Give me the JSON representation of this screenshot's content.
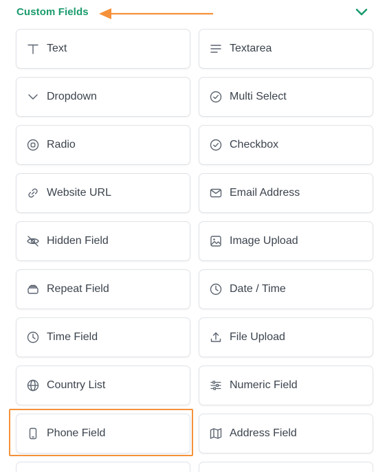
{
  "header": {
    "title": "Custom Fields",
    "accent_color": "#1a9b6c",
    "annotation_color": "#f5913a"
  },
  "fields": [
    {
      "label": "Text",
      "icon": "text-icon"
    },
    {
      "label": "Textarea",
      "icon": "textarea-icon"
    },
    {
      "label": "Dropdown",
      "icon": "chevron-down-icon"
    },
    {
      "label": "Multi Select",
      "icon": "check-circle-icon"
    },
    {
      "label": "Radio",
      "icon": "radio-icon"
    },
    {
      "label": "Checkbox",
      "icon": "check-circle-icon"
    },
    {
      "label": "Website URL",
      "icon": "link-icon"
    },
    {
      "label": "Email Address",
      "icon": "envelope-icon"
    },
    {
      "label": "Hidden Field",
      "icon": "eye-off-icon"
    },
    {
      "label": "Image Upload",
      "icon": "image-icon"
    },
    {
      "label": "Repeat Field",
      "icon": "stack-icon"
    },
    {
      "label": "Date / Time",
      "icon": "clock-icon"
    },
    {
      "label": "Time Field",
      "icon": "clock-icon"
    },
    {
      "label": "File Upload",
      "icon": "upload-icon"
    },
    {
      "label": "Country List",
      "icon": "globe-icon"
    },
    {
      "label": "Numeric Field",
      "icon": "sliders-icon"
    },
    {
      "label": "Phone Field",
      "icon": "phone-icon"
    },
    {
      "label": "Address Field",
      "icon": "map-icon"
    }
  ]
}
